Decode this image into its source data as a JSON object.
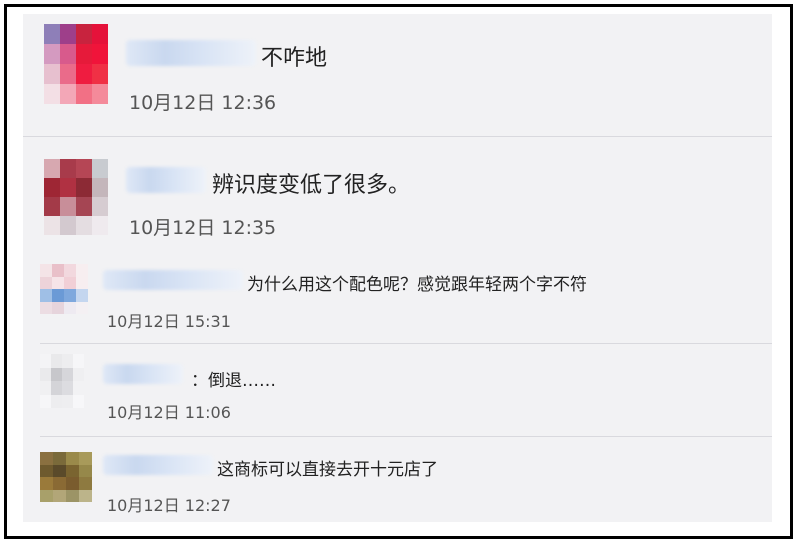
{
  "comments": [
    {
      "text": "不咋地",
      "time": "10月12日 12:36",
      "avatar_colors": [
        "#8e7fb8",
        "#9e3f8a",
        "#c8233e",
        "#e5123a",
        "#d49ac0",
        "#d85a8c",
        "#e61a3a",
        "#f0143a",
        "#e7c0cf",
        "#ea6b8a",
        "#ef1c40",
        "#f03045",
        "#f3dfe5",
        "#f3a7b7",
        "#f27085",
        "#f48a9a"
      ]
    },
    {
      "text": "辨识度变低了很多。",
      "time": "10月12日 12:35",
      "avatar_colors": [
        "#d7a8b0",
        "#a83b4b",
        "#b54655",
        "#c8cbd0",
        "#9e2634",
        "#b03142",
        "#8c2a35",
        "#c4b6bb",
        "#a33a48",
        "#c88e99",
        "#a54553",
        "#d6ccd1",
        "#ece3e6",
        "#d3c9cf",
        "#e4dde1",
        "#efeaee"
      ]
    },
    {
      "text": "为什么用这个配色呢？感觉跟年轻两个字不符",
      "time": "10月12日 15:31",
      "avatar_colors": [
        "#f4e4e7",
        "#e9c0c9",
        "#f2d8de",
        "#f7eef0",
        "#edd3d9",
        "#f6e4e8",
        "#f1cfd6",
        "#f7eef0",
        "#9fbfe6",
        "#6b9ad6",
        "#7fa8dd",
        "#c4d6ef",
        "#ecdde3",
        "#e6d4dc",
        "#eeeaf1",
        "#f4f0f3"
      ]
    },
    {
      "text": "：倒退……",
      "time": "10月12日 11:06",
      "avatar_colors": [
        "#f4f4f6",
        "#e9e9eb",
        "#ededef",
        "#f6f6f8",
        "#eaeaec",
        "#c7c7cb",
        "#d6d6da",
        "#efeff1",
        "#f0f0f2",
        "#d4d4d8",
        "#dcdce0",
        "#f2f2f4",
        "#f6f6f8",
        "#ededef",
        "#eeeef0",
        "#f7f7f9"
      ]
    },
    {
      "text": "这商标可以直接去开十元店了",
      "time": "10月12日 12:27",
      "avatar_colors": [
        "#8a7040",
        "#7a6a3a",
        "#9a8a4a",
        "#a89a5a",
        "#6e5a2e",
        "#5a4a2a",
        "#7a6430",
        "#96884a",
        "#9a7a3a",
        "#8a6a34",
        "#7a5c2e",
        "#8e7a40",
        "#a8a06a",
        "#b2a678",
        "#9c9466",
        "#bcb48a"
      ]
    }
  ]
}
